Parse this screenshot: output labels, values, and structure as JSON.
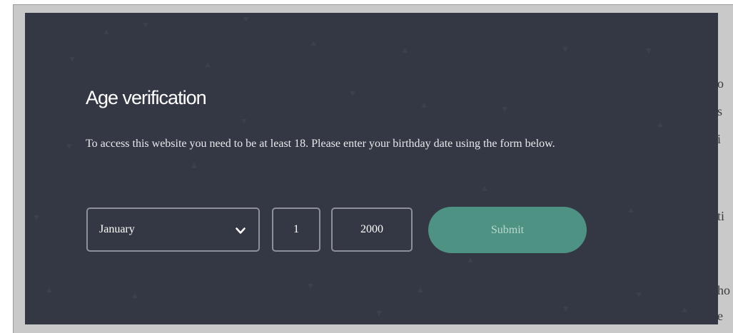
{
  "background_page": {
    "text_fragments": [
      "o",
      "s",
      "i",
      "ti",
      "ho",
      "e"
    ]
  },
  "modal": {
    "title": "Age verification",
    "description": "To access this website you need to be at least 18. Please enter your birthday date using the form below.",
    "month": {
      "selected": "January",
      "icon": "chevron-down-icon"
    },
    "day": "1",
    "year": "2000",
    "submit_label": "Submit",
    "colors": {
      "background": "#343844",
      "submit": "#4e9284",
      "border": "#8d9098"
    }
  }
}
